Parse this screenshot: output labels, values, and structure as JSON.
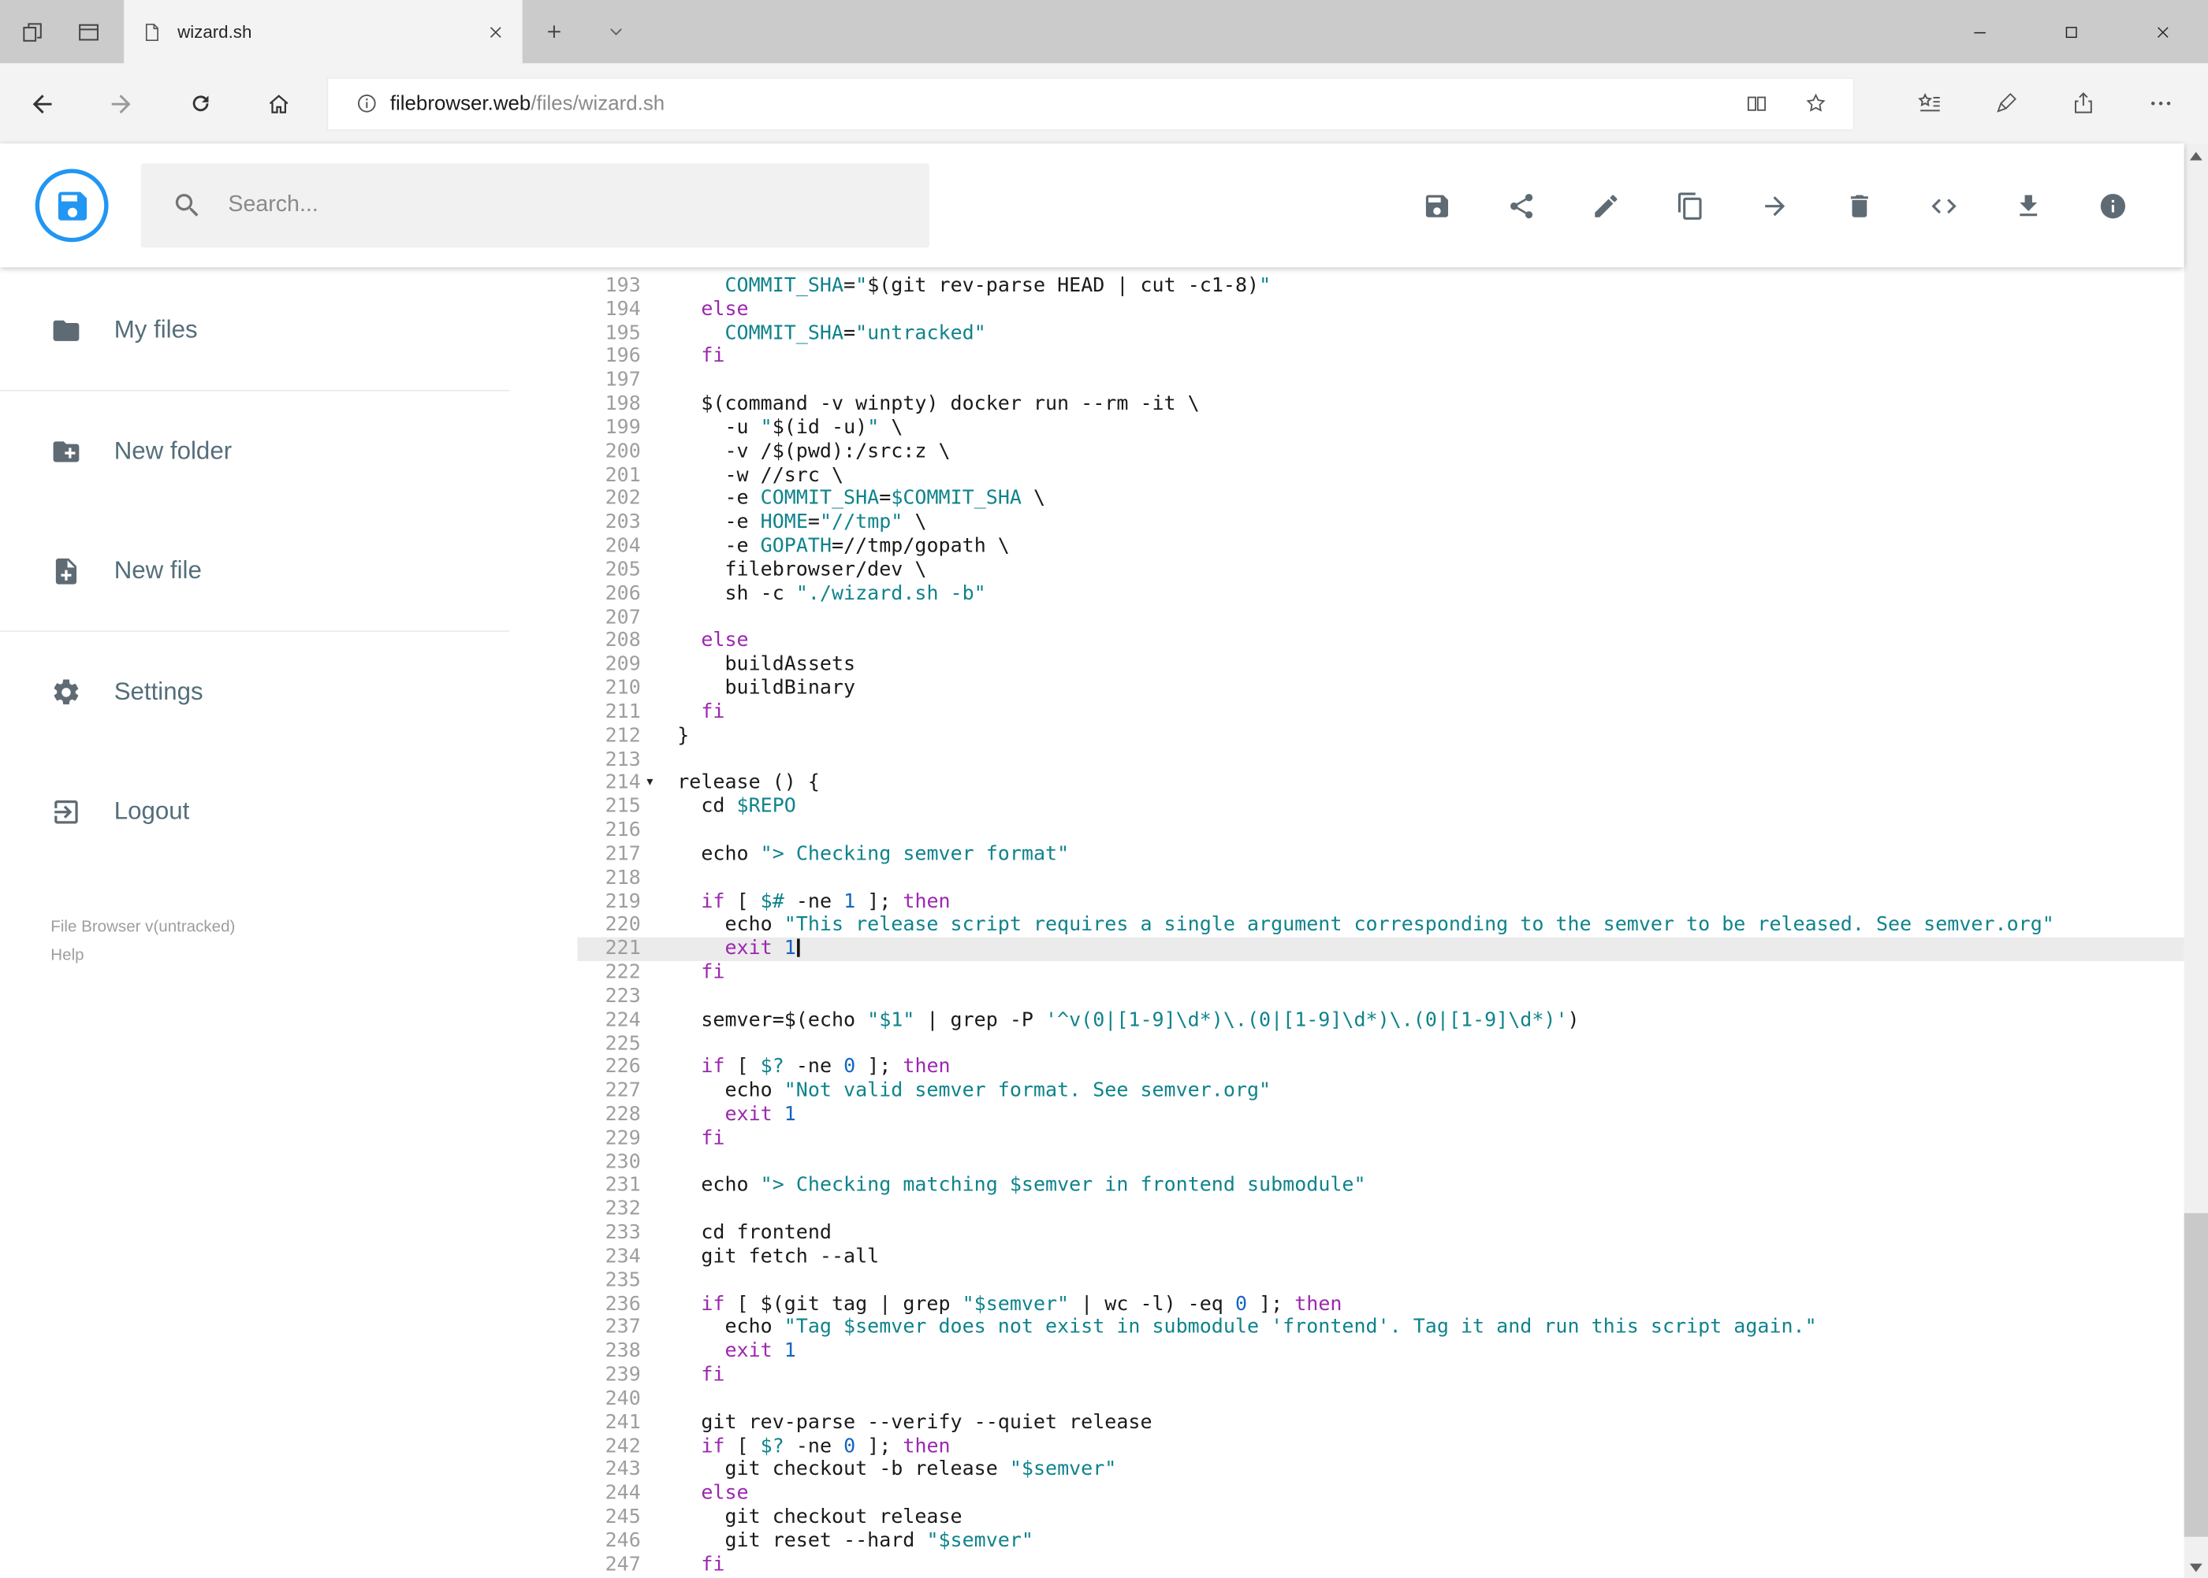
{
  "browser": {
    "tab": {
      "title": "wizard.sh"
    },
    "address": {
      "host": "filebrowser.web",
      "path": "/files/wizard.sh"
    }
  },
  "header": {
    "search_placeholder": "Search..."
  },
  "sidebar": {
    "items": [
      {
        "label": "My files"
      },
      {
        "label": "New folder"
      },
      {
        "label": "New file"
      },
      {
        "label": "Settings"
      },
      {
        "label": "Logout"
      }
    ],
    "footer": {
      "version": "File Browser v(untracked)",
      "help": "Help"
    }
  },
  "editor": {
    "first_line": 193,
    "active_line": 221,
    "fold_marker_lines": [
      214
    ],
    "lines": [
      "    COMMIT_SHA=\"$(git rev-parse HEAD | cut -c1-8)\"",
      "  else",
      "    COMMIT_SHA=\"untracked\"",
      "  fi",
      "",
      "  $(command -v winpty) docker run --rm -it \\",
      "    -u \"$(id -u)\" \\",
      "    -v /$(pwd):/src:z \\",
      "    -w //src \\",
      "    -e COMMIT_SHA=$COMMIT_SHA \\",
      "    -e HOME=\"//tmp\" \\",
      "    -e GOPATH=//tmp/gopath \\",
      "    filebrowser/dev \\",
      "    sh -c \"./wizard.sh -b\"",
      "",
      "  else",
      "    buildAssets",
      "    buildBinary",
      "  fi",
      "}",
      "",
      "release () {",
      "  cd $REPO",
      "",
      "  echo \"> Checking semver format\"",
      "",
      "  if [ $# -ne 1 ]; then",
      "    echo \"This release script requires a single argument corresponding to the semver to be released. See semver.org\"",
      "    exit 1",
      "  fi",
      "",
      "  semver=$(echo \"$1\" | grep -P '^v(0|[1-9]\\d*)\\.(0|[1-9]\\d*)\\.(0|[1-9]\\d*)')",
      "",
      "  if [ $? -ne 0 ]; then",
      "    echo \"Not valid semver format. See semver.org\"",
      "    exit 1",
      "  fi",
      "",
      "  echo \"> Checking matching $semver in frontend submodule\"",
      "",
      "  cd frontend",
      "  git fetch --all",
      "",
      "  if [ $(git tag | grep \"$semver\" | wc -l) -eq 0 ]; then",
      "    echo \"Tag $semver does not exist in submodule 'frontend'. Tag it and run this script again.\"",
      "    exit 1",
      "  fi",
      "",
      "  git rev-parse --verify --quiet release",
      "  if [ $? -ne 0 ]; then",
      "    git checkout -b release \"$semver\"",
      "  else",
      "    git checkout release",
      "    git reset --hard \"$semver\"",
      "  fi"
    ]
  },
  "colors": {
    "accent": "#2196f3",
    "keyword": "#9c27b0",
    "string": "#0f838c",
    "variable": "#0f838c",
    "number": "#1565c0",
    "icon": "#5f6b74"
  }
}
